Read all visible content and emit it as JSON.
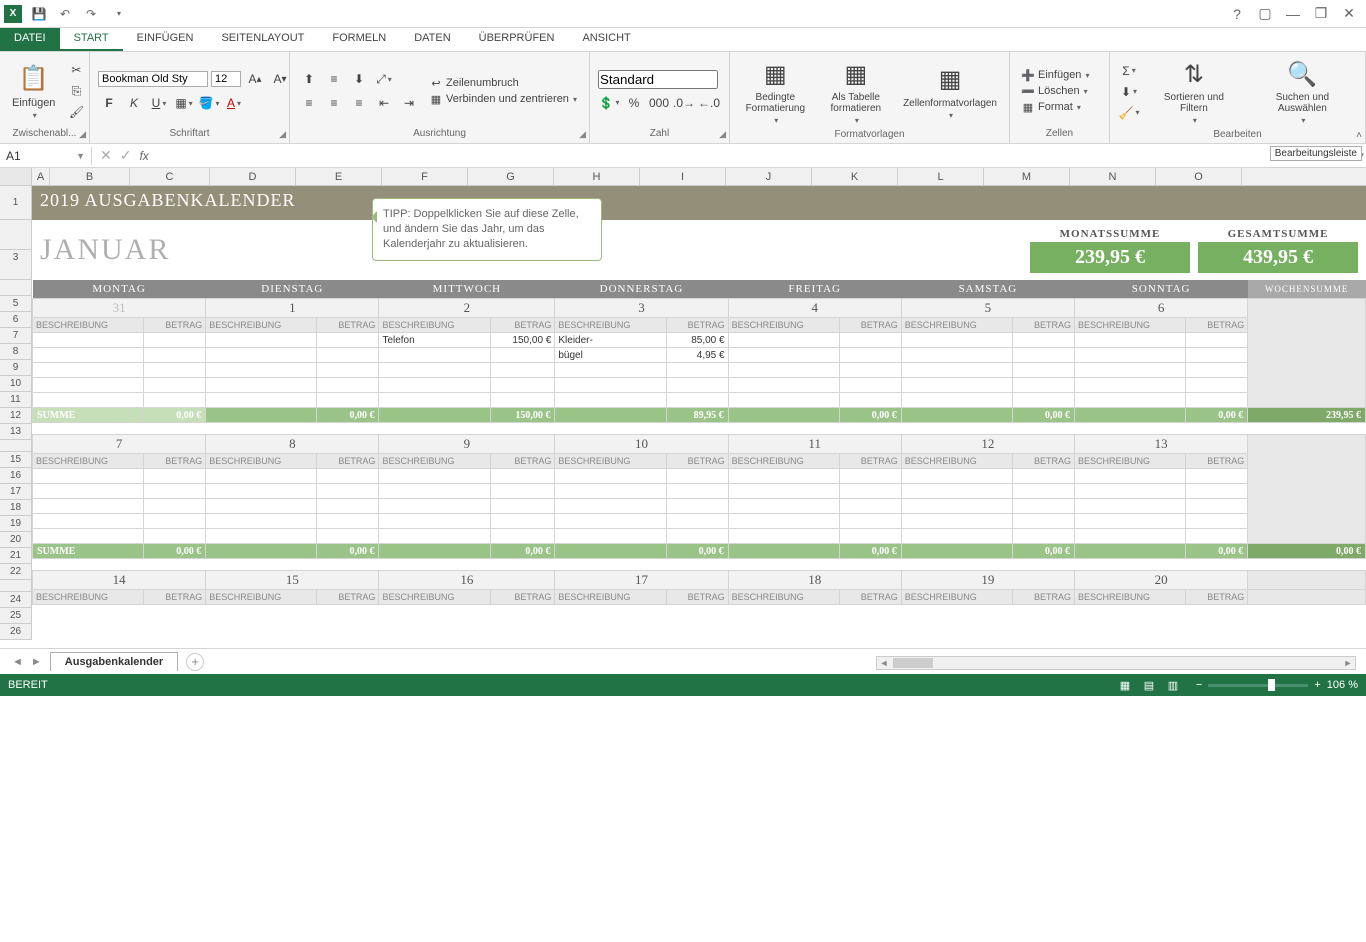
{
  "titlebar": {
    "app": "X"
  },
  "tabs": {
    "file": "DATEI",
    "start": "START",
    "insert": "EINFÜGEN",
    "layout": "SEITENLAYOUT",
    "formulas": "FORMELN",
    "data": "DATEN",
    "review": "ÜBERPRÜFEN",
    "view": "ANSICHT"
  },
  "ribbon": {
    "clipboard": {
      "paste": "Einfügen",
      "label": "Zwischenabl..."
    },
    "font": {
      "name": "Bookman Old Sty",
      "size": "12",
      "label": "Schriftart"
    },
    "align": {
      "wrap": "Zeilenumbruch",
      "merge": "Verbinden und zentrieren",
      "label": "Ausrichtung"
    },
    "number": {
      "format": "Standard",
      "label": "Zahl"
    },
    "styles": {
      "cond": "Bedingte Formatierung",
      "table": "Als Tabelle formatieren",
      "cell": "Zellenformatvorlagen",
      "label": "Formatvorlagen"
    },
    "cells": {
      "insert": "Einfügen",
      "delete": "Löschen",
      "format": "Format",
      "label": "Zellen"
    },
    "edit": {
      "sort": "Sortieren und Filtern",
      "find": "Suchen und Auswählen",
      "label": "Bearbeiten"
    }
  },
  "namebox": "A1",
  "tooltip": "Bearbeitungsleiste",
  "columns": [
    "A",
    "B",
    "C",
    "D",
    "E",
    "F",
    "G",
    "H",
    "I",
    "J",
    "K",
    "L",
    "M",
    "N",
    "O"
  ],
  "sheet": {
    "title": "2019 AUSGABENKALENDER",
    "tip": "TIPP: Doppelklicken Sie auf diese Zelle, und ändern Sie das Jahr, um das Kalenderjahr zu aktualisieren.",
    "month": "JANUAR",
    "monatssumme_label": "MONATSSUMME",
    "monatssumme": "239,95 €",
    "gesamtsumme_label": "GESAMTSUMME",
    "gesamtsumme": "439,95 €",
    "days": [
      "MONTAG",
      "DIENSTAG",
      "MITTWOCH",
      "DONNERSTAG",
      "FREITAG",
      "SAMSTAG",
      "SONNTAG"
    ],
    "wochensumme": "WOCHENSUMME",
    "beschreibung": "BESCHREIBUNG",
    "betrag": "BETRAG",
    "summe": "SUMME",
    "week1": {
      "dates": [
        "31",
        "1",
        "2",
        "3",
        "4",
        "5",
        "6"
      ],
      "entries": {
        "telefon": "Telefon",
        "telefon_val": "150,00 €",
        "kleider": "Kleider-bügel",
        "kleider_v1": "85,00 €",
        "kleider_v2": "4,95 €"
      },
      "sums": [
        "0,00 €",
        "0,00 €",
        "150,00 €",
        "89,95 €",
        "0,00 €",
        "0,00 €",
        "0,00 €"
      ],
      "ws": "239,95 €"
    },
    "week2": {
      "dates": [
        "7",
        "8",
        "9",
        "10",
        "11",
        "12",
        "13"
      ],
      "sums": [
        "0,00 €",
        "0,00 €",
        "0,00 €",
        "0,00 €",
        "0,00 €",
        "0,00 €",
        "0,00 €"
      ],
      "ws": "0,00 €"
    },
    "week3": {
      "dates": [
        "14",
        "15",
        "16",
        "17",
        "18",
        "19",
        "20"
      ]
    }
  },
  "tabname": "Ausgabenkalender",
  "status": "BEREIT",
  "zoom": "106 %"
}
